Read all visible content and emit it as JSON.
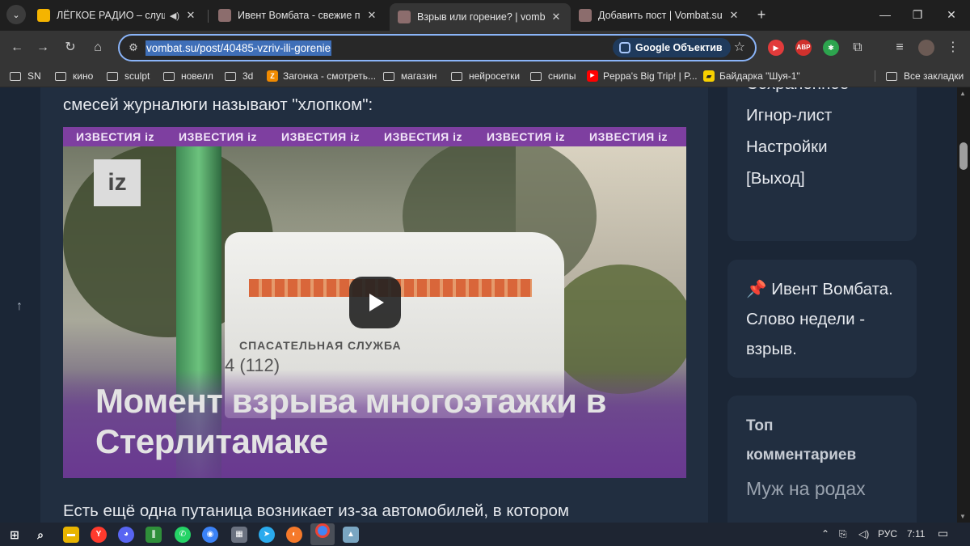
{
  "tabs": [
    {
      "title": "ЛЁГКОЕ РАДИО – слушать",
      "favicon_color": "#f5b400",
      "audio": true
    },
    {
      "title": "Ивент Вомбата - свежие посты",
      "favicon_color": "#8c6d6d"
    },
    {
      "title": "Взрыв или горение? | vombat.su",
      "favicon_color": "#8c6d6d",
      "active": true
    },
    {
      "title": "Добавить пост | Vombat.su",
      "favicon_color": "#8c6d6d"
    }
  ],
  "address_bar": {
    "url": "vombat.su/post/40485-vzriv-ili-gorenie",
    "lens_label": "Google Объектив"
  },
  "extensions": [
    {
      "name": "media-ext",
      "color": "#e23b3b",
      "label": "▶"
    },
    {
      "name": "adblock",
      "color": "#d0312d",
      "label": "ABP"
    },
    {
      "name": "color-ext",
      "color": "#2da44e",
      "label": "✱"
    }
  ],
  "bookmarks": [
    {
      "label": "SN",
      "type": "folder"
    },
    {
      "label": "кино",
      "type": "folder"
    },
    {
      "label": "sculpt",
      "type": "folder"
    },
    {
      "label": "новелл",
      "type": "folder"
    },
    {
      "label": "3d",
      "type": "folder"
    },
    {
      "label": "Загонка - смотреть...",
      "type": "site",
      "color": "#f08a00",
      "glyph": "Z"
    },
    {
      "label": "магазин",
      "type": "folder"
    },
    {
      "label": "нейросетки",
      "type": "folder"
    },
    {
      "label": "снипы",
      "type": "folder"
    },
    {
      "label": "Peppa's Big Trip! | P...",
      "type": "site",
      "color": "#ff0000",
      "glyph": "▶"
    },
    {
      "label": "Байдарка \"Шуя-1\"",
      "type": "site",
      "color": "#f7d000",
      "glyph": "▰"
    }
  ],
  "all_bookmarks_label": "Все закладки",
  "article": {
    "lead_text": "смесей журналюги называют \"хлопком\":",
    "video": {
      "banner_repeat_text": "ИЗВЕСТИЯ iz",
      "logo": "iz",
      "van_text": "СПАСАТЕЛЬНАЯ СЛУЖБА",
      "van_number": "4 (112)",
      "headline": "Момент взрыва многоэтажки в Стерлитамаке"
    },
    "next_paragraph": "Есть ещё одна путаница возникает из-за автомобилей, в котором"
  },
  "sidebar": {
    "menu_items": [
      "Сохранённое",
      "Игнор-лист",
      "Настройки",
      "[Выход]"
    ],
    "pinned": {
      "lines": [
        "📌 Ивент Вомбата.",
        "Слово недели -",
        "взрыв."
      ]
    },
    "top_comments": {
      "heading_lines": [
        "Топ",
        "комментариев"
      ],
      "first_comment": "Муж на родах"
    }
  },
  "taskbar": {
    "apps": [
      {
        "name": "file-explorer",
        "color": "#e8b400",
        "glyph": "▬"
      },
      {
        "name": "yandex-browser",
        "color": "#ff3a2d",
        "glyph": "Y"
      },
      {
        "name": "discord",
        "color": "#5865f2",
        "glyph": "◕"
      },
      {
        "name": "app-green",
        "color": "#2f8f3a",
        "glyph": "∥"
      },
      {
        "name": "whatsapp",
        "color": "#25d366",
        "glyph": "✆"
      },
      {
        "name": "app-blue",
        "color": "#3b82f6",
        "glyph": "◉"
      },
      {
        "name": "calculator",
        "color": "#6b7280",
        "glyph": "▦"
      },
      {
        "name": "telegram",
        "color": "#2aabee",
        "glyph": "➤"
      },
      {
        "name": "blender",
        "color": "#f5792a",
        "glyph": "◐"
      },
      {
        "name": "chrome",
        "color": "#4285f4",
        "glyph": "◎",
        "active": true
      },
      {
        "name": "app-landscape",
        "color": "#7aa6c2",
        "glyph": "▲"
      }
    ],
    "language": "РУС",
    "time": "7:11"
  }
}
